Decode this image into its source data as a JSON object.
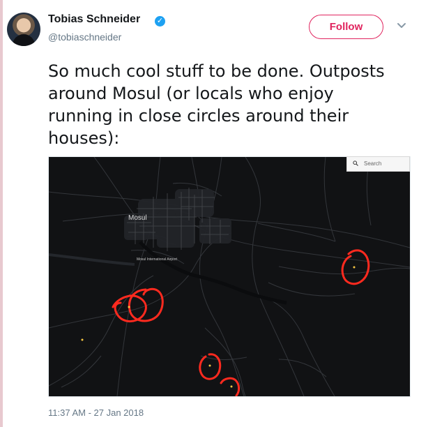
{
  "author": {
    "name": "Tobias Schneider",
    "handle": "@tobiaschneider",
    "verified": true
  },
  "follow_label": "Follow",
  "tweet_lines": [
    "So much cool stuff to be done. Outposts",
    "around Mosul (or locals who enjoy",
    "running in close circles around their",
    "houses):"
  ],
  "map": {
    "search_placeholder": "Search",
    "city_label": "Mosul",
    "airport_label": "Mosul International Airport",
    "marker_color": "#ff2a1f",
    "background_color": "#111214"
  },
  "timestamp": "11:37 AM - 27 Jan 2018",
  "colors": {
    "follow": "#e0245e",
    "verified": "#1da1f2",
    "left_rule": "#e8c9cf"
  }
}
